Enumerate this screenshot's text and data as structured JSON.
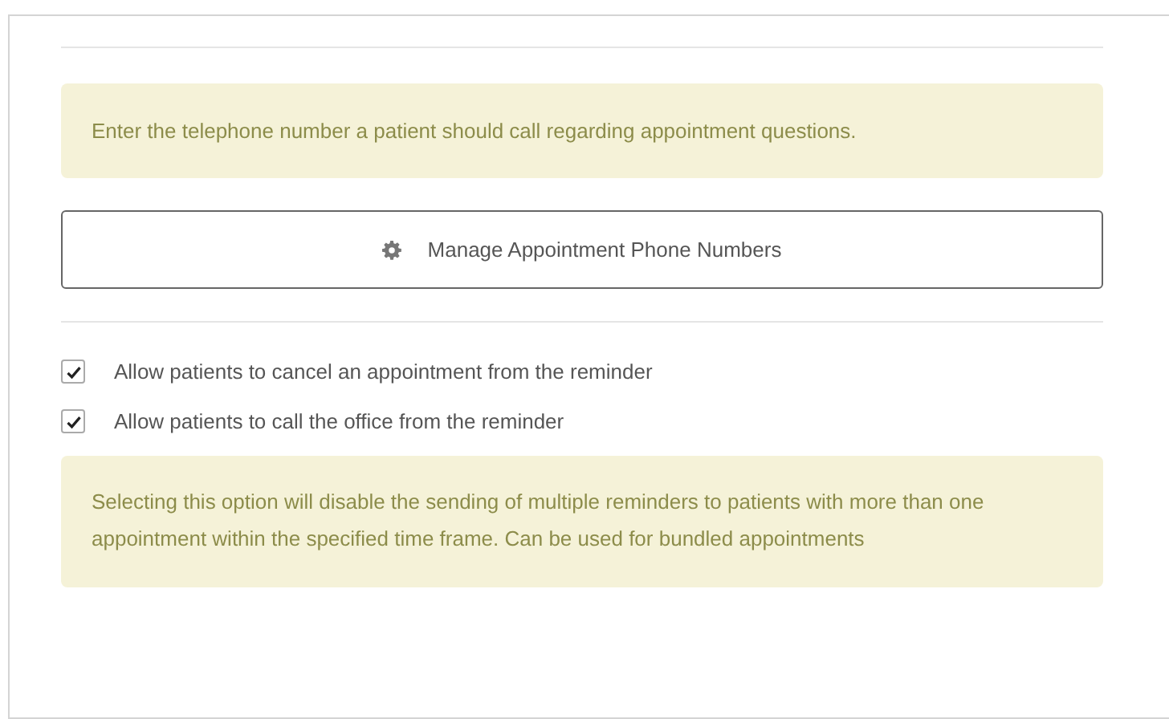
{
  "notes": [
    {
      "text": "Enter the telephone number a patient should call regarding appointment questions."
    },
    {
      "text": "Selecting this option will disable the sending of multiple reminders to patients with more than one appointment within the specified time frame. Can be used for bundled appointments"
    }
  ],
  "manage_button": {
    "label": "Manage Appointment Phone Numbers"
  },
  "options": [
    {
      "label": "Allow patients to cancel an appointment from the reminder",
      "checked": true
    },
    {
      "label": "Allow patients to call the office from the reminder",
      "checked": true
    }
  ]
}
